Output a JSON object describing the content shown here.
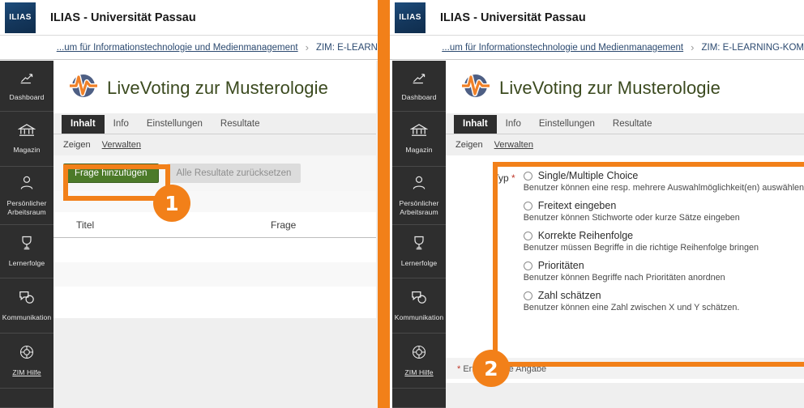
{
  "header": {
    "logo_text": "ILIAS",
    "title": "ILIAS - Universität Passau"
  },
  "breadcrumb": {
    "item1": "...um für Informationstechnologie und Medienmanagement",
    "separator": "›",
    "item2_left": "ZIM: E-LEARN",
    "item2_right": "ZIM: E-LEARNING-KOM"
  },
  "sidebar": {
    "items": [
      {
        "label": "Dashboard",
        "icon": "dashboard-icon"
      },
      {
        "label": "Magazin",
        "icon": "bank-icon"
      },
      {
        "label": "Persönlicher",
        "label2": "Arbeitsraum",
        "icon": "person-icon"
      },
      {
        "label": "Lernerfolge",
        "icon": "trophy-icon"
      },
      {
        "label": "Kommunikation",
        "icon": "chat-icon"
      },
      {
        "label": "ZIM Hilfe",
        "icon": "lifering-icon"
      }
    ]
  },
  "page": {
    "title": "LiveVoting zur Musterologie",
    "icon": "livevoting-pulse-icon"
  },
  "tabs": [
    {
      "label": "Inhalt",
      "active": true
    },
    {
      "label": "Info",
      "active": false
    },
    {
      "label": "Einstellungen",
      "active": false
    },
    {
      "label": "Resultate",
      "active": false
    }
  ],
  "subtabs": [
    {
      "label": "Zeigen",
      "link": false
    },
    {
      "label": "Verwalten",
      "link": true
    }
  ],
  "toolbar": {
    "add_question_label": "Frage hinzufügen",
    "reset_results_label": "Alle Resultate zurücksetzen"
  },
  "table": {
    "columns": [
      "Titel",
      "Frage"
    ]
  },
  "form": {
    "label": "Typ",
    "required_marker": "*",
    "options": [
      {
        "title": "Single/Multiple Choice",
        "desc": "Benutzer können eine resp. mehrere Auswahlmöglichkeit(en) auswählen"
      },
      {
        "title": "Freitext eingeben",
        "desc": "Benutzer können Stichworte oder kurze Sätze eingeben"
      },
      {
        "title": "Korrekte Reihenfolge",
        "desc": "Benutzer müssen Begriffe in die richtige Reihenfolge bringen"
      },
      {
        "title": "Prioritäten",
        "desc": "Benutzer können Begriffe nach Prioritäten anordnen"
      },
      {
        "title": "Zahl schätzen",
        "desc": "Benutzer können eine Zahl zwischen X und Y schätzen."
      }
    ],
    "required_note_star": "*",
    "required_note_text": "Erforderliche Angabe"
  },
  "annotations": {
    "badge1": "1",
    "badge2": "2"
  },
  "colors": {
    "accent_orange": "#f28019",
    "brand_blue": "#1d4d7d",
    "button_green": "#4c7a29",
    "nav_dark": "#2e2e2e",
    "title_olive": "#3b4a1f"
  }
}
